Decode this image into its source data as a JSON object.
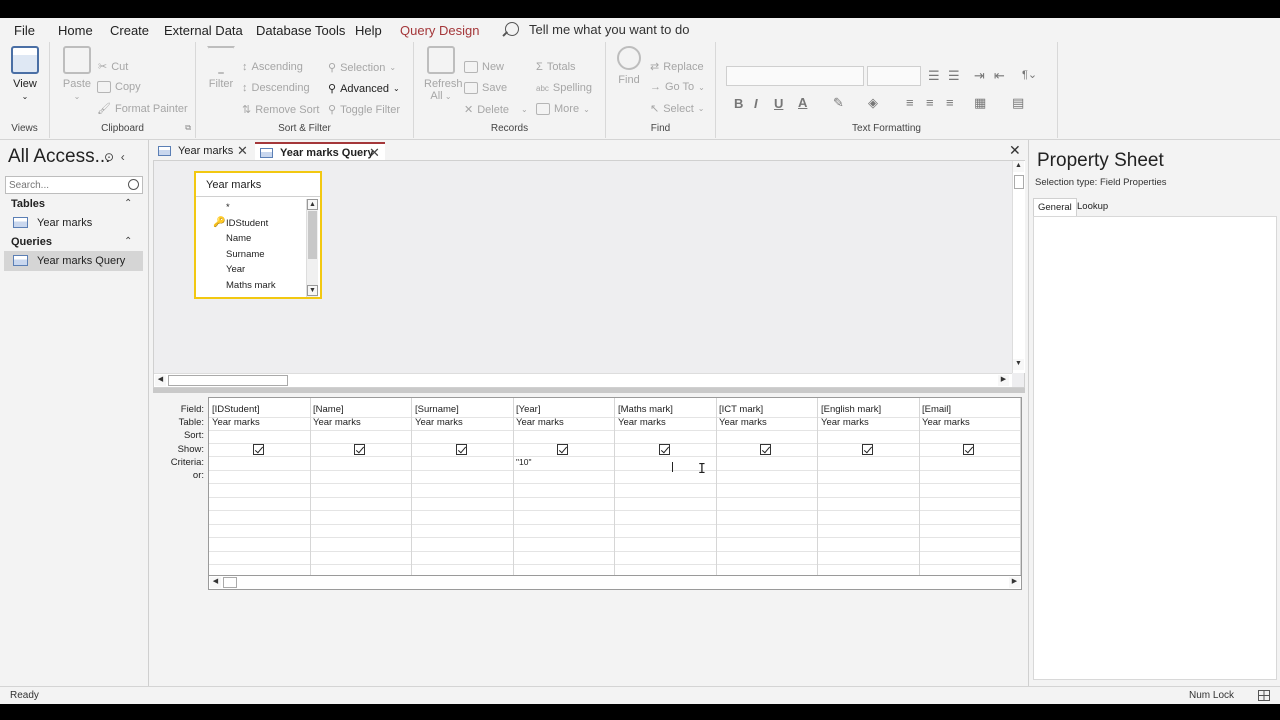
{
  "menu": {
    "file": "File",
    "home": "Home",
    "create": "Create",
    "external": "External Data",
    "dbtools": "Database Tools",
    "help": "Help",
    "query_design": "Query Design",
    "tell_me": "Tell me what you want to do"
  },
  "ribbon": {
    "views": {
      "label": "Views",
      "view": "View"
    },
    "clipboard": {
      "label": "Clipboard",
      "paste": "Paste",
      "cut": "Cut",
      "copy": "Copy",
      "format_painter": "Format Painter"
    },
    "sort_filter": {
      "label": "Sort & Filter",
      "filter": "Filter",
      "ascending": "Ascending",
      "descending": "Descending",
      "remove_sort": "Remove Sort",
      "selection": "Selection",
      "advanced": "Advanced",
      "toggle_filter": "Toggle Filter"
    },
    "records": {
      "label": "Records",
      "refresh": "Refresh",
      "refresh_all": "All",
      "new": "New",
      "save": "Save",
      "delete": "Delete",
      "totals": "Totals",
      "spelling": "Spelling",
      "more": "More"
    },
    "find": {
      "label": "Find",
      "find": "Find",
      "replace": "Replace",
      "goto": "Go To",
      "select": "Select"
    },
    "text_formatting": {
      "label": "Text Formatting"
    }
  },
  "nav": {
    "title": "All Access...",
    "search_placeholder": "Search...",
    "tables_header": "Tables",
    "tables": [
      "Year marks"
    ],
    "queries_header": "Queries",
    "queries": [
      "Year marks Query"
    ]
  },
  "tabs": [
    {
      "label": "Year marks",
      "active": false
    },
    {
      "label": "Year marks Query",
      "active": true
    }
  ],
  "field_list": {
    "title": "Year marks",
    "fields": [
      "*",
      "IDStudent",
      "Name",
      "Surname",
      "Year",
      "Maths mark"
    ]
  },
  "grid": {
    "row_labels": [
      "Field:",
      "Table:",
      "Sort:",
      "Show:",
      "Criteria:",
      "or:"
    ],
    "columns": [
      {
        "field": "[IDStudent]",
        "table": "Year marks",
        "show": true,
        "criteria": ""
      },
      {
        "field": "[Name]",
        "table": "Year marks",
        "show": true,
        "criteria": ""
      },
      {
        "field": "[Surname]",
        "table": "Year marks",
        "show": true,
        "criteria": ""
      },
      {
        "field": "[Year]",
        "table": "Year marks",
        "show": true,
        "criteria": "\"10\""
      },
      {
        "field": "[Maths mark]",
        "table": "Year marks",
        "show": true,
        "criteria": ""
      },
      {
        "field": "[ICT mark]",
        "table": "Year marks",
        "show": true,
        "criteria": ""
      },
      {
        "field": "[English mark]",
        "table": "Year marks",
        "show": true,
        "criteria": ""
      },
      {
        "field": "[Email]",
        "table": "Year marks",
        "show": true,
        "criteria": ""
      }
    ]
  },
  "property_sheet": {
    "title": "Property Sheet",
    "selection_type": "Selection type:  Field Properties",
    "tabs": [
      "General",
      "Lookup"
    ]
  },
  "status": {
    "left": "Ready",
    "right": "Num Lock"
  },
  "colors": {
    "accent": "#a4373a",
    "selection_border": "#f2c811"
  }
}
